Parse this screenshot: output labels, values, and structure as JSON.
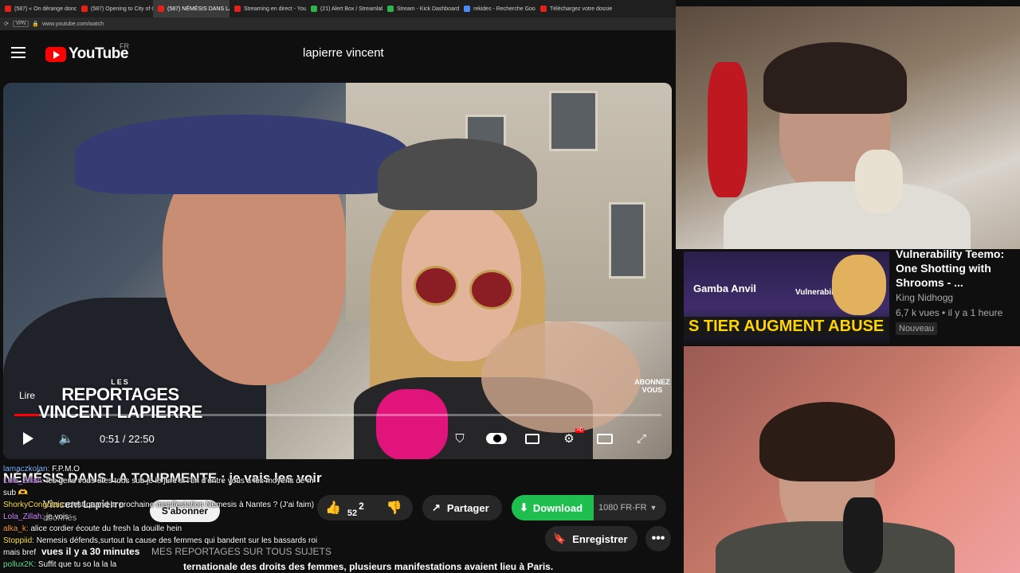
{
  "browser": {
    "tabs": [
      {
        "label": "(587) « On dérange donc »",
        "active": false
      },
      {
        "label": "(587) Opening to City of G",
        "active": false
      },
      {
        "label": "(587) NÉMÉSIS DANS LA",
        "active": true
      },
      {
        "label": "Streaming en direct - YouT",
        "active": false
      },
      {
        "label": "(21) Alert Box / Streamlabs",
        "active": false
      },
      {
        "label": "Stream - Kick Dashboard",
        "active": false
      },
      {
        "label": "rekides - Recherche Goog",
        "active": false
      },
      {
        "label": "Téléchargez votre dossier",
        "active": false
      }
    ],
    "url": "www.youtube.com/watch",
    "badge": "VPN"
  },
  "youtube": {
    "logo_text": "YouTube",
    "country": "FR",
    "search_value": "lapierre vincent"
  },
  "player": {
    "overlay_les": "LES",
    "overlay_title_1": "REPORTAGES",
    "overlay_title_2": "VINCENT LAPIERRE",
    "overlay_lire": "Lire",
    "overlay_abonnez": "ABONNEZ VOUS",
    "progress_fraction": 0.038,
    "time": "0:51 / 22:50",
    "hd_badge": "HD"
  },
  "video": {
    "title": "NÉMÉSIS DANS LA TOURMENTE : je vais les voir",
    "channel": "Vincent Lapierre",
    "subscribers": "abonnés",
    "subscribe_label": "S'abonner",
    "likes": "2",
    "likes_overlay": "52",
    "share_label": "Partager",
    "download_label": "Download",
    "download_quality": "1080 FR-FR",
    "save_label": "Enregistrer",
    "views": "vues  il y a",
    "minutes": "30 minutes",
    "tags": "MES REPORTAGES SUR TOUS SUJETS",
    "description": "ternationale des droits des femmes, plusieurs manifestations avaient lieu à Paris."
  },
  "chat": [
    {
      "user": "lamaczkolan:",
      "msg": "F.P.M.O",
      "cls": "u1"
    },
    {
      "user": "Lola_Zillah:",
      "msg": "les gens vous êtes tous sub je le jure si l'un d'entre vous a les moyens de m'",
      "cls": "u3"
    },
    {
      "user": "",
      "msg": "sub 🫶",
      "cls": "u1"
    },
    {
      "user": "ShorkyCongolais:",
      "msg": "c'est quand la prochaine manifestation Nemesis à Nantes ? (J'ai faim)",
      "cls": "u5"
    },
    {
      "user": "Lola_Zillah:",
      "msg": "je vois",
      "cls": "u3"
    },
    {
      "user": "alka_k:",
      "msg": "alice cordier écoute du fresh la douille hein",
      "cls": "u2"
    },
    {
      "user": "Stoppiid:",
      "msg": "Nemesis défends,surtout la cause des femmes qui bandent sur les bassards roi",
      "cls": "u5"
    },
    {
      "user": "",
      "msg": "mais bref",
      "cls": "u1"
    },
    {
      "user": "pollux2K:",
      "msg": "Suffit que tu so la la la",
      "cls": "u4"
    }
  ],
  "sidebar_video": {
    "title": "Vulnerability Teemo: One Shotting with Shrooms - ...",
    "channel": "King Nidhogg",
    "meta": "6,7 k vues • il y a 1 heure",
    "badge": "Nouveau",
    "thumb_text_1": "Gamba Anvil",
    "thumb_text_2": "Vulnerability",
    "thumb_banner": "S TIER AUGMENT ABUSE"
  }
}
